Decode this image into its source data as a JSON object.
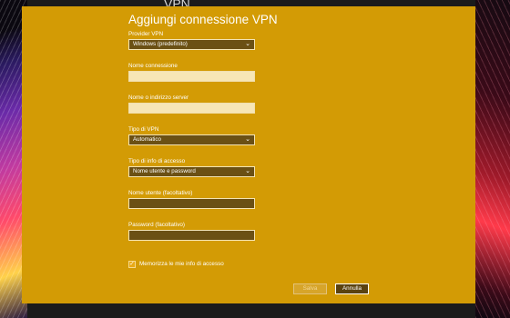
{
  "background_window": {
    "title": "VPN"
  },
  "dialog": {
    "title": "Aggiungi connessione VPN",
    "provider": {
      "label": "Provider VPN",
      "value": "Windows (predefinito)"
    },
    "connection_name": {
      "label": "Nome connessione",
      "value": ""
    },
    "server": {
      "label": "Nome o indirizzo server",
      "value": ""
    },
    "vpn_type": {
      "label": "Tipo di VPN",
      "value": "Automatico"
    },
    "signin_type": {
      "label": "Tipo di info di accesso",
      "value": "Nome utente e password"
    },
    "username": {
      "label": "Nome utente (facoltativo)",
      "value": ""
    },
    "password": {
      "label": "Password (facoltativo)",
      "value": ""
    },
    "remember": {
      "label": "Memorizza le mie info di accesso",
      "checked": true
    },
    "save_label": "Salva",
    "cancel_label": "Annulla"
  },
  "colors": {
    "accent": "#d39b05",
    "field_dark": "#6b5014",
    "field_light": "#f7e6b6"
  },
  "icons": {
    "dropdown": "chevron-down-icon",
    "check": "checkmark-icon"
  }
}
